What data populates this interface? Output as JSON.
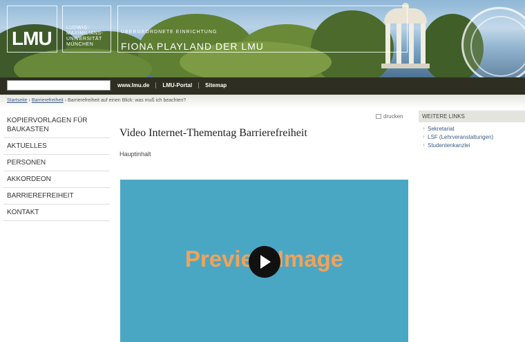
{
  "header": {
    "logo": "LMU",
    "university_lines": [
      "Ludwig-",
      "Maximilians-",
      "Universität",
      "München"
    ],
    "facility_label": "Übergeordnete Einrichtung",
    "facility_name": "FIONA PLAYLAND DER LMU",
    "search_placeholder": "",
    "top_links": [
      "www.lmu.de",
      "LMU-Portal",
      "Sitemap"
    ]
  },
  "breadcrumb": {
    "items": [
      "Startseite",
      "Barrierefreiheit"
    ],
    "current": "Barrierefreiheit auf einen Blick: was muß ich beachten?",
    "separator": "›"
  },
  "left_nav": {
    "items": [
      "Kopiervorlagen für Baukasten",
      "Aktuelles",
      "Personen",
      "Akkordeon",
      "Barrierefreiheit",
      "Kontakt"
    ]
  },
  "main": {
    "print_label": "drucken",
    "title": "Video Internet-Thementag Barrierefreiheit",
    "subheading": "Hauptinhalt",
    "video": {
      "preview_text": "Preview Image"
    }
  },
  "right": {
    "heading": "Weitere Links",
    "links": [
      "Sekretariat",
      "LSF (Lehrveranstaltungen)",
      "Studentenkanzlei"
    ]
  },
  "colors": {
    "nav_bar": "#2e2f22",
    "video_bg": "#4aa7c4",
    "preview_text": "#f0a35a",
    "link": "#3b5a86"
  }
}
